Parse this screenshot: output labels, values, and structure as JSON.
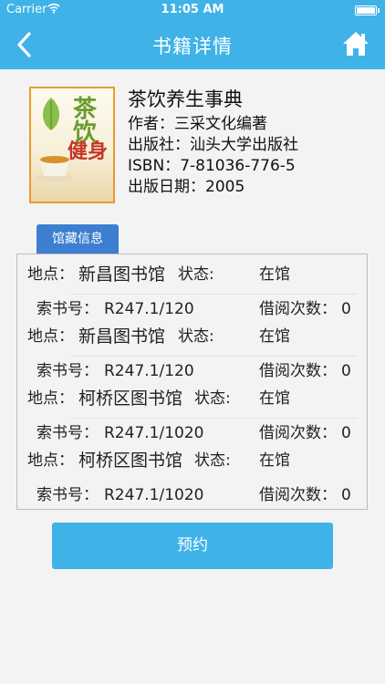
{
  "status_bar": {
    "carrier": "Carrier",
    "time": "11:05 AM"
  },
  "nav": {
    "title": "书籍详情",
    "back_icon": "chevron-left-icon",
    "home_icon": "home-icon"
  },
  "book": {
    "title": "茶饮养生事典",
    "author_label": "作者：",
    "author": "三采文化编著",
    "publisher_label": "出版社：",
    "publisher": "汕头大学出版社",
    "isbn_label": "ISBN：",
    "isbn": "7-81036-776-5",
    "date_label": "出版日期：",
    "date": "2005",
    "cover_text": {
      "line1": "茶饮",
      "line2": "健身"
    }
  },
  "holdings_tab": "馆藏信息",
  "holdings": [
    {
      "location_label": "地点：",
      "location": "新昌图书馆",
      "status_label": "状态:",
      "status": "在馆",
      "call_label": "索书号：",
      "call_number": "R247.1/120",
      "borrow_label": "借阅次数：",
      "borrow_count": "0"
    },
    {
      "location_label": "地点：",
      "location": "新昌图书馆",
      "status_label": "状态:",
      "status": "在馆",
      "call_label": "索书号：",
      "call_number": "R247.1/120",
      "borrow_label": "借阅次数：",
      "borrow_count": "0"
    },
    {
      "location_label": "地点：",
      "location": "柯桥区图书馆",
      "status_label": "状态:",
      "status": "在馆",
      "call_label": "索书号：",
      "call_number": "R247.1/1020",
      "borrow_label": "借阅次数：",
      "borrow_count": "0"
    },
    {
      "location_label": "地点：",
      "location": "柯桥区图书馆",
      "status_label": "状态:",
      "status": "在馆",
      "call_label": "索书号：",
      "call_number": "R247.1/1020",
      "borrow_label": "借阅次数：",
      "borrow_count": "0"
    }
  ],
  "reserve_button": "预约",
  "colors": {
    "primary": "#3fb2e8",
    "tab": "#3c7fd0",
    "background": "#f3f3f3"
  }
}
